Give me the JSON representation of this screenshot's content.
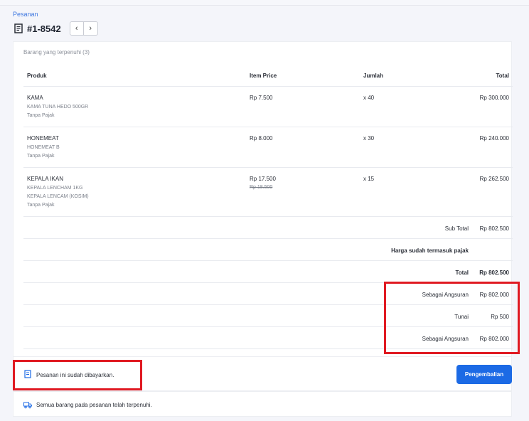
{
  "breadcrumb": "Pesanan",
  "order_id": "#1-8542",
  "nav": {
    "prev": "‹",
    "next": "›"
  },
  "fulfilled_title": "Barang yang terpenuhi (3)",
  "table": {
    "headers": {
      "product": "Produk",
      "price": "Item Price",
      "qty": "Jumlah",
      "total": "Total"
    },
    "items": [
      {
        "name": "KAMA",
        "lines": [
          "KAMA TUNA HEDO 500GR",
          "Tanpa Pajak"
        ],
        "price": "Rp 7.500",
        "old_price": "",
        "qty": "x 40",
        "total": "Rp 300.000"
      },
      {
        "name": "HONEMEAT",
        "lines": [
          "HONEMEAT B",
          "Tanpa Pajak"
        ],
        "price": "Rp 8.000",
        "old_price": "",
        "qty": "x 30",
        "total": "Rp 240.000"
      },
      {
        "name": "KEPALA IKAN",
        "lines": [
          "KEPALA LENCHAM 1KG",
          "KEPALA LENCAM (KOSIM)",
          "Tanpa Pajak"
        ],
        "price": "Rp 17.500",
        "old_price": "Rp 18.500",
        "qty": "x 15",
        "total": "Rp 262.500"
      }
    ]
  },
  "summary": {
    "subtotal_label": "Sub Total",
    "subtotal_value": "Rp 802.500",
    "tax_note": "Harga sudah termasuk pajak",
    "total_label": "Total",
    "total_value": "Rp 802.500",
    "payments": [
      {
        "label": "Sebagai Angsuran",
        "value": "Rp 802.000"
      },
      {
        "label": "Tunai",
        "value": "Rp 500"
      },
      {
        "label": "Sebagai Angsuran",
        "value": "Rp 802.000"
      }
    ]
  },
  "paid_notice": "Pesanan ini sudah dibayarkan.",
  "return_button": "Pengembalian",
  "fulfilled_notice": "Semua barang pada pesanan telah terpenuhi.",
  "colors": {
    "accent": "#1c6ae5",
    "highlight": "#e01a22",
    "link": "#3f78e0"
  }
}
